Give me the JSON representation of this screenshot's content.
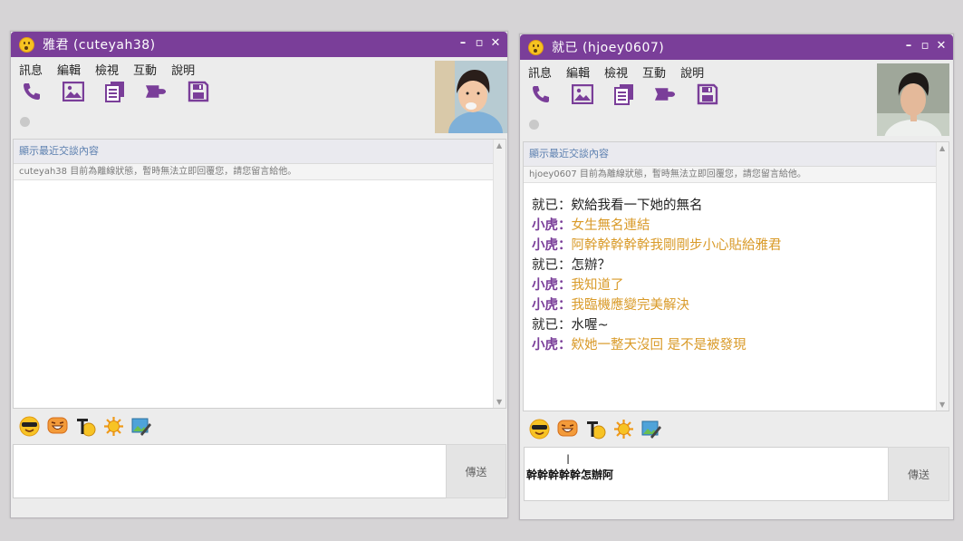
{
  "colors": {
    "titlebar": "#7a3e99",
    "accent": "#7a3e99",
    "sender_self": "#222222",
    "sender_other": "#7a3e99",
    "text_other": "#d99a28"
  },
  "menu": [
    "訊息",
    "編輯",
    "檢視",
    "互動",
    "說明"
  ],
  "toolbar_icons": [
    "phone-icon",
    "photo-icon",
    "files-icon",
    "plugin-icon",
    "save-icon"
  ],
  "emoji_icons": [
    "sunglasses-face-icon",
    "laughing-face-icon",
    "font-style-icon",
    "sun-icon",
    "edit-image-icon"
  ],
  "left": {
    "title": "雅君 (cuteyah38)",
    "recent": "顯示最近交談內容",
    "offline_notice": "cuteyah38 目前為離線狀態，暫時無法立即回覆您，請您留言給他。",
    "input_value": "",
    "send_label": "傳送"
  },
  "right": {
    "title": "就已 (hjoey0607)",
    "recent": "顯示最近交談內容",
    "offline_notice": "hjoey0607 目前為離線狀態，暫時無法立即回覆您，請您留言給他。",
    "messages": [
      {
        "sender": "就已：",
        "text": "欸給我看一下她的無名",
        "self": true
      },
      {
        "sender": "小虎：",
        "text": "女生無名連結",
        "self": false
      },
      {
        "sender": "小虎：",
        "text": "阿幹幹幹幹幹我剛剛步小心貼給雅君",
        "self": false
      },
      {
        "sender": "就已：",
        "text": "怎辦？",
        "self": true
      },
      {
        "sender": "小虎：",
        "text": "我知道了",
        "self": false
      },
      {
        "sender": "小虎：",
        "text": "我臨機應變完美解決",
        "self": false
      },
      {
        "sender": "就已：",
        "text": "水喔~",
        "self": true
      },
      {
        "sender": "小虎：",
        "text": "欸她一整天沒回 是不是被發現",
        "self": false
      }
    ],
    "input_value": "幹幹幹幹幹怎辦阿",
    "send_label": "傳送"
  }
}
